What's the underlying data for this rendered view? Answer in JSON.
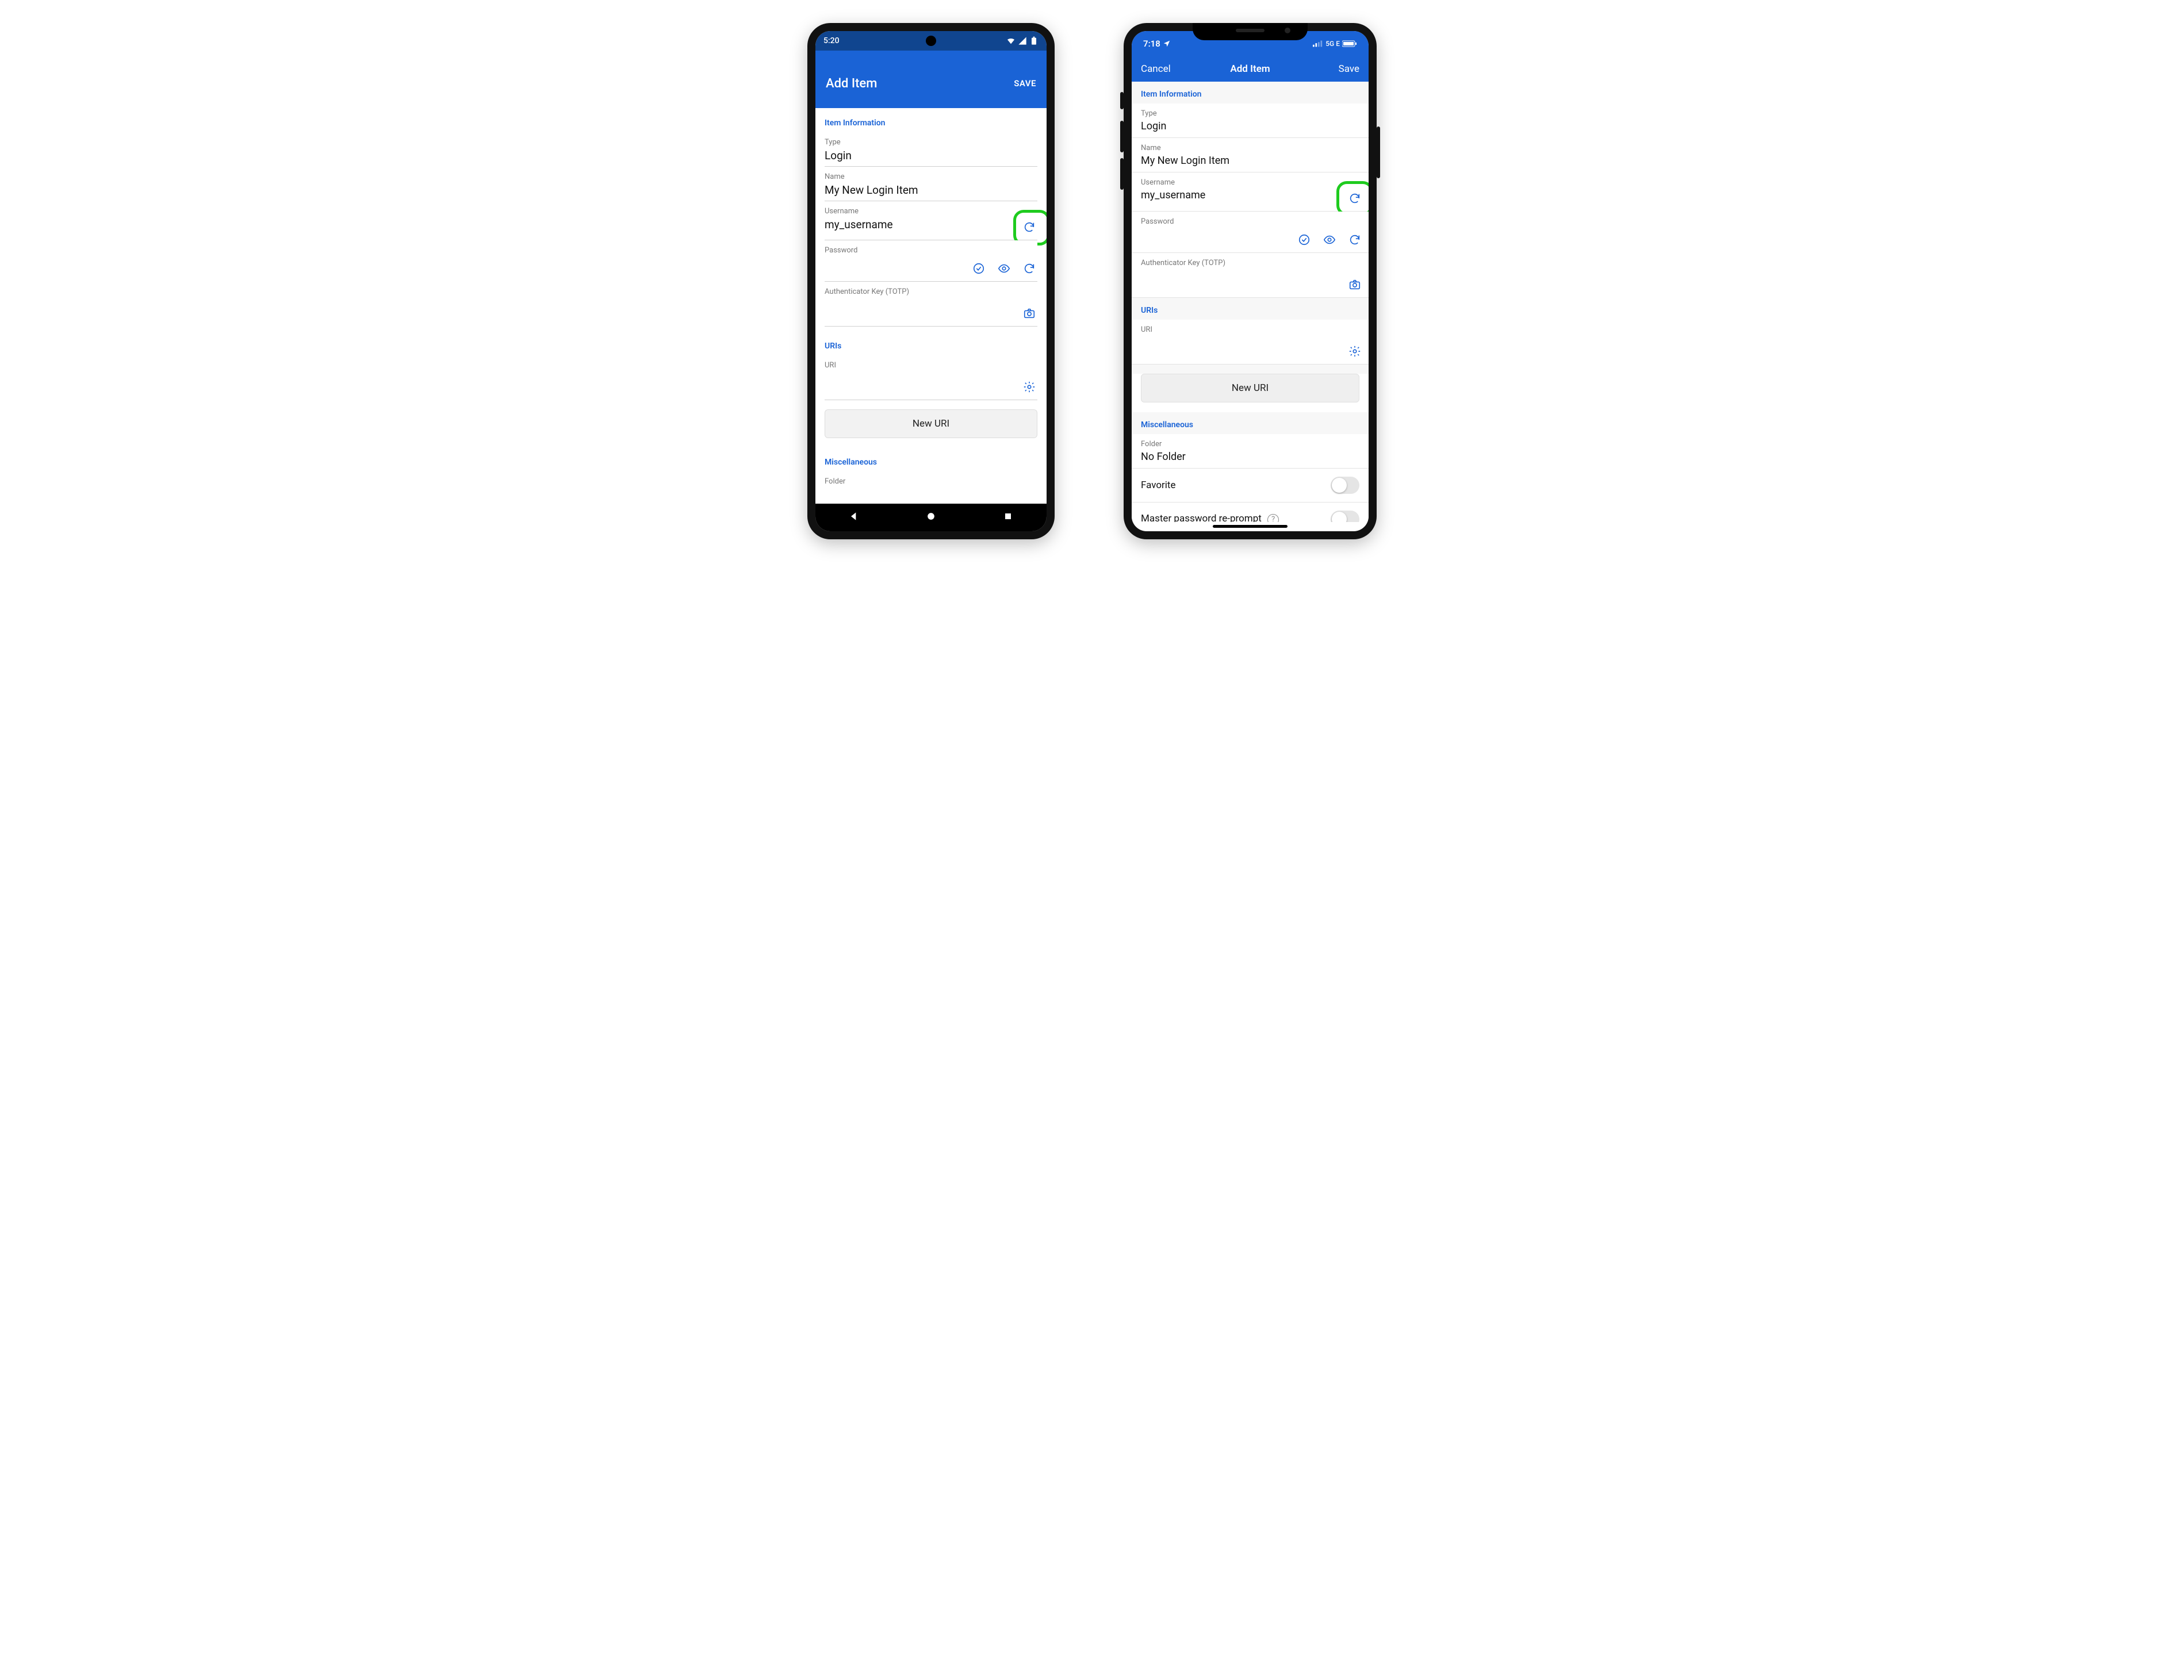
{
  "android": {
    "status": {
      "time": "5:20"
    },
    "header": {
      "title": "Add Item",
      "save": "SAVE"
    },
    "sections": {
      "item_info": "Item Information",
      "uris": "URIs",
      "misc": "Miscellaneous"
    },
    "fields": {
      "type_label": "Type",
      "type_value": "Login",
      "name_label": "Name",
      "name_value": "My New Login Item",
      "username_label": "Username",
      "username_value": "my_username",
      "password_label": "Password",
      "password_value": "",
      "totp_label": "Authenticator Key (TOTP)",
      "totp_value": "",
      "uri_label": "URI",
      "uri_value": "",
      "new_uri": "New URI",
      "folder_label": "Folder"
    }
  },
  "ios": {
    "status": {
      "time": "7:18",
      "net": "5G E"
    },
    "header": {
      "cancel": "Cancel",
      "title": "Add Item",
      "save": "Save"
    },
    "sections": {
      "item_info": "Item Information",
      "uris": "URIs",
      "misc": "Miscellaneous"
    },
    "fields": {
      "type_label": "Type",
      "type_value": "Login",
      "name_label": "Name",
      "name_value": "My New Login Item",
      "username_label": "Username",
      "username_value": "my_username",
      "password_label": "Password",
      "password_value": "",
      "totp_label": "Authenticator Key (TOTP)",
      "totp_value": "",
      "uri_label": "URI",
      "uri_value": "",
      "new_uri": "New URI",
      "folder_label": "Folder",
      "folder_value": "No Folder",
      "favorite_label": "Favorite",
      "reprompt_label": "Master password re-prompt"
    }
  }
}
